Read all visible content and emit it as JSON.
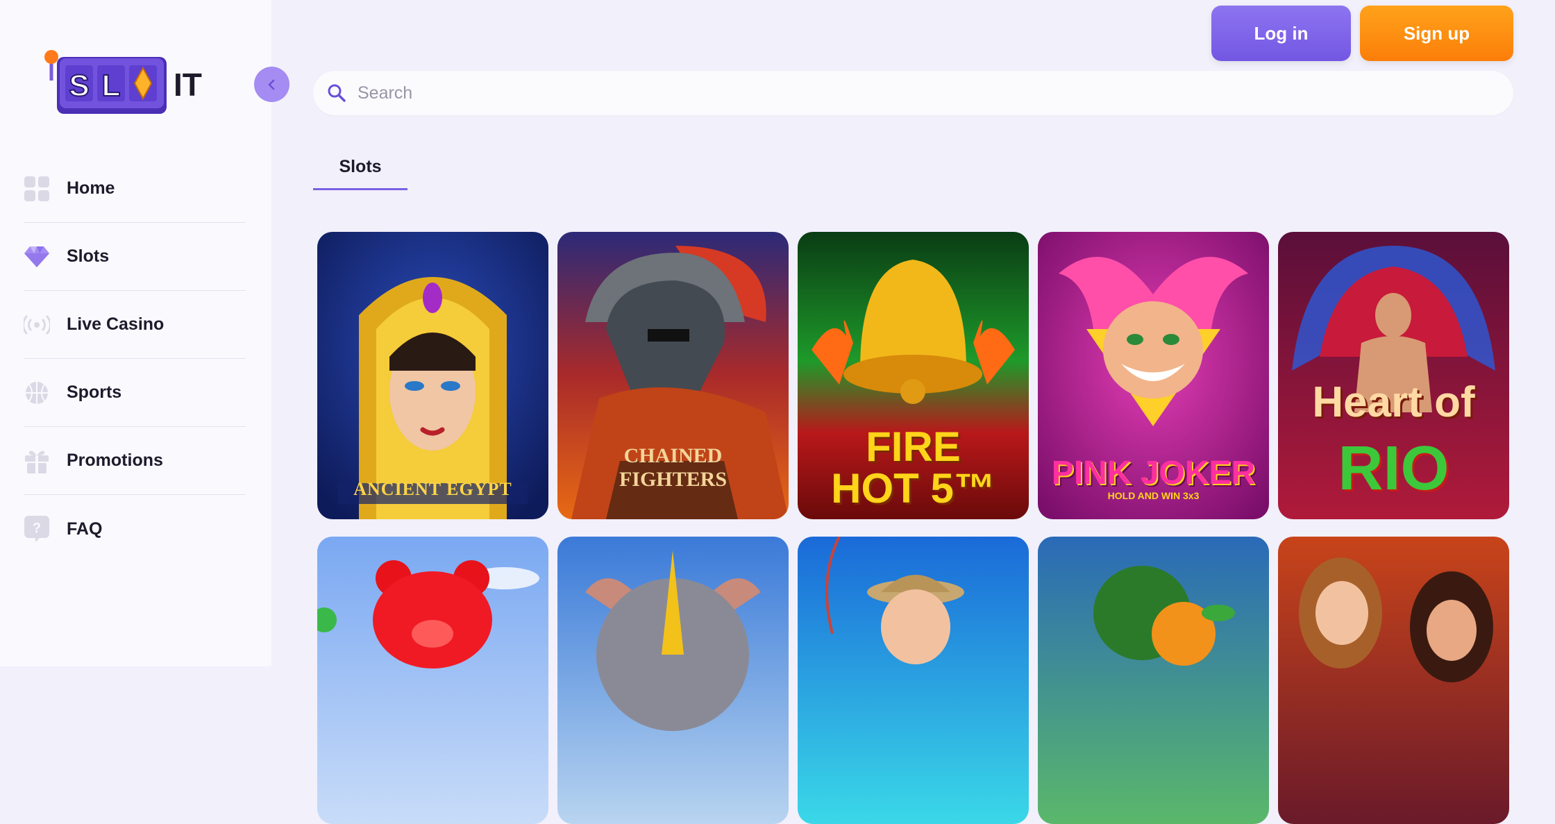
{
  "brand": {
    "logo_text_boxed": "SL",
    "logo_diamond": "◆",
    "logo_text_boxed2": "T",
    "logo_text_plain": "IT"
  },
  "header": {
    "login_label": "Log in",
    "signup_label": "Sign up"
  },
  "search": {
    "placeholder": "Search",
    "value": ""
  },
  "tabs": [
    {
      "label": "Slots",
      "active": true
    }
  ],
  "sidebar": {
    "items": [
      {
        "label": "Home",
        "icon": "grid-icon"
      },
      {
        "label": "Slots",
        "icon": "diamond-icon"
      },
      {
        "label": "Live Casino",
        "icon": "broadcast-icon"
      },
      {
        "label": "Sports",
        "icon": "ball-icon"
      },
      {
        "label": "Promotions",
        "icon": "gift-icon"
      },
      {
        "label": "FAQ",
        "icon": "question-icon"
      }
    ]
  },
  "games": [
    {
      "title": "ANCIENT EGYPT"
    },
    {
      "title": "CHAINED FIGHTERS"
    },
    {
      "title": "FIRE HOT 5™"
    },
    {
      "title": "PINK JOKER",
      "subtitle": "HOLD AND WIN 3x3"
    },
    {
      "title": "Heart of",
      "title2": "RIO"
    },
    {
      "title": ""
    },
    {
      "title": ""
    },
    {
      "title": ""
    },
    {
      "title": ""
    },
    {
      "title": ""
    }
  ],
  "colors": {
    "accent": "#7a62e0",
    "signup": "#fb8a0f",
    "background": "#f2f0fb"
  }
}
